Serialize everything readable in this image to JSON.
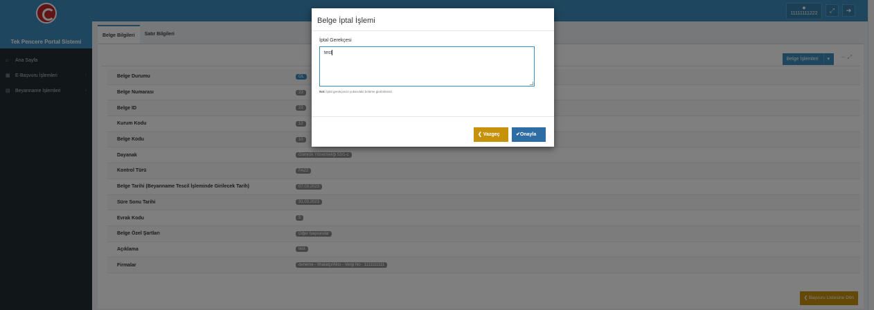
{
  "sidebar": {
    "brand": "Tek Pencere Portal Sistemi",
    "items": [
      {
        "icon": "home-icon",
        "glyph": "⌂",
        "label": "Ana Sayfa"
      },
      {
        "icon": "chart-icon",
        "glyph": "▦",
        "label": "E-Başvuru İşlemleri"
      },
      {
        "icon": "list-icon",
        "glyph": "▤",
        "label": "Beyanname İşlemleri"
      }
    ]
  },
  "topbar": {
    "user_id": "11111111222"
  },
  "tabs": [
    "Belge Bilgileri",
    "Satır Bilgileri"
  ],
  "panel": {
    "actions_label": "Belge İşlemleri",
    "back_label": "Başvuru Listesine Dön",
    "rows": [
      {
        "label": "Belge Durumu",
        "value": "OL"
      },
      {
        "label": "Belge Numarası",
        "value": "23"
      },
      {
        "label": "Belge ID",
        "value": "23"
      },
      {
        "label": "Kurum Kodu",
        "value": "12"
      },
      {
        "label": "Belge Kodu",
        "value": "10"
      },
      {
        "label": "Dayanak",
        "value": "Gümrük Yönetmeliği 53/1-c"
      },
      {
        "label": "Kontrol Türü",
        "value": "FAZ2"
      },
      {
        "label": "Belge Tarihi (Beyanname Tescil İşleminde Girilecek Tarih)",
        "value": "07.03.2023"
      },
      {
        "label": "Süre Sonu Tarihi",
        "value": "31.03.2023"
      },
      {
        "label": "Evrak Kodu",
        "value": "5"
      },
      {
        "label": "Belge Özel Şartları",
        "value": "Diğer başvurular"
      },
      {
        "label": "Açıklama",
        "value": "test"
      },
      {
        "label": "Firmalar",
        "value": "deneme - İthalatçı/Alıcı - Vergi No : 1111111111"
      }
    ]
  },
  "modal": {
    "title": "Belge İptal İşlemi",
    "field_label": "İptal Gerekçesi",
    "textarea_value": "test",
    "note_bold": "Not:",
    "note_text": "İptal gerekçenizi yukarıdaki bölüme girebilirsiniz.",
    "cancel_label": "Vazgeç",
    "confirm_label": "Onayla"
  },
  "colors": {
    "primary": "#3c8dbc",
    "sidebar": "#222d32",
    "warning": "#c6920b",
    "confirm": "#2e6da4"
  }
}
